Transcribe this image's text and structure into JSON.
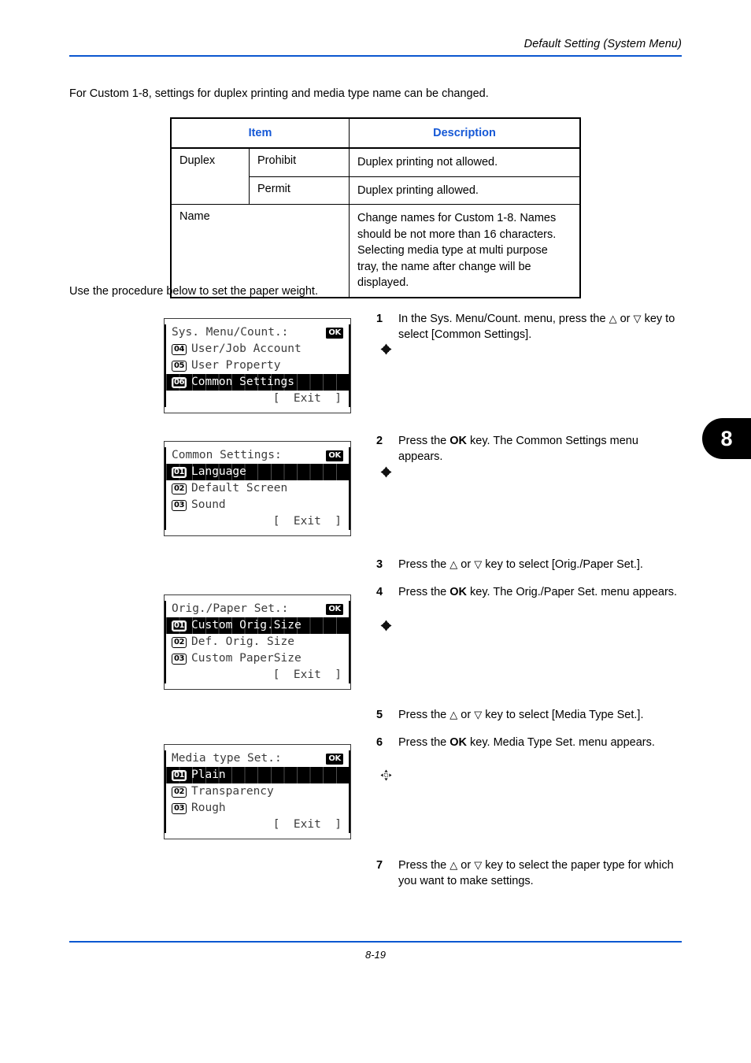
{
  "header": {
    "title": "Default Setting (System Menu)"
  },
  "footer": {
    "page_number": "8-19"
  },
  "chapter_tab": {
    "number": "8"
  },
  "intro": {
    "paragraph": "For Custom 1-8, settings for duplex printing and media type name can be changed.",
    "procedure_paragraph": "Use the procedure below to set the paper weight."
  },
  "spec_table": {
    "header_color": "#1558D6",
    "columns": [
      "Item",
      "Description"
    ],
    "rows": [
      {
        "item": "Duplex",
        "sub": "Prohibit",
        "description": "Duplex printing not allowed."
      },
      {
        "item": "",
        "sub": "Permit",
        "description": "Duplex printing allowed."
      },
      {
        "item": "Name",
        "sub": "",
        "description": "Change names for Custom 1-8. Names should be not more than 16 characters. Selecting media type at multi purpose tray, the name after change will be displayed."
      }
    ]
  },
  "lcd_screens": [
    {
      "title": "Sys. Menu/Count.:",
      "icons": [
        "four-way-arrow-icon",
        "ok-key-icon"
      ],
      "ok_label": "OK",
      "rows": [
        {
          "num": "04",
          "label": "User/Job Account",
          "selected": false
        },
        {
          "num": "05",
          "label": "User Property",
          "selected": false
        },
        {
          "num": "06",
          "label": "Common Settings",
          "selected": true
        }
      ],
      "exit_label": "[  Exit  ]"
    },
    {
      "title": "Common Settings:",
      "icons": [
        "four-way-arrow-icon",
        "ok-key-icon"
      ],
      "ok_label": "OK",
      "rows": [
        {
          "num": "01",
          "label": "Language",
          "selected": true
        },
        {
          "num": "02",
          "label": "Default Screen",
          "selected": false
        },
        {
          "num": "03",
          "label": "Sound",
          "selected": false
        }
      ],
      "exit_label": "[  Exit  ]"
    },
    {
      "title": "Orig./Paper Set.:",
      "icons": [
        "four-way-arrow-icon",
        "ok-key-icon"
      ],
      "ok_label": "OK",
      "rows": [
        {
          "num": "01",
          "label": "Custom Orig.Size",
          "selected": true
        },
        {
          "num": "02",
          "label": "Def. Orig. Size",
          "selected": false
        },
        {
          "num": "03",
          "label": "Custom PaperSize",
          "selected": false
        }
      ],
      "exit_label": "[  Exit  ]"
    },
    {
      "title": "Media type Set.:",
      "icons": [
        "four-way-arrow-dotted-icon",
        "ok-key-icon"
      ],
      "ok_label": "OK",
      "rows": [
        {
          "num": "01",
          "label": "Plain",
          "selected": true
        },
        {
          "num": "02",
          "label": "Transparency",
          "selected": false
        },
        {
          "num": "03",
          "label": "Rough",
          "selected": false
        }
      ],
      "exit_label": "[  Exit  ]"
    }
  ],
  "steps": [
    {
      "number": "1",
      "parts": [
        {
          "t": "In the Sys. Menu/Count. menu, press the ",
          "b": false
        },
        {
          "t": "△",
          "b": false
        },
        {
          "t": " or ",
          "b": false
        },
        {
          "t": "▽",
          "b": false
        },
        {
          "t": " key to select [Common Settings].",
          "b": false
        }
      ],
      "text": "In the Sys. Menu/Count. menu, press the △ or ▽ key to select [Common Settings]."
    },
    {
      "number": "2",
      "text": "Press the OK key. The Common Settings menu appears."
    },
    {
      "number": "3",
      "text": "Press the △ or ▽ key to select [Orig./Paper Set.]."
    },
    {
      "number": "4",
      "text": "Press the OK key. The Orig./Paper Set. menu appears."
    },
    {
      "number": "5",
      "text": "Press the △ or ▽ key to select [Media Type Set.]."
    },
    {
      "number": "6",
      "text": "Press the OK key. Media Type Set. menu appears."
    },
    {
      "number": "7",
      "text": "Press the △ or ▽ key to select the paper type for which you want to make settings."
    }
  ],
  "step_fragments": {
    "s1_a": "In the Sys. Menu/Count. menu, press the ",
    "s1_b": " or ",
    "s1_c": " key to select [Common Settings].",
    "s2_a": "Press the ",
    "s2_ok": "OK",
    "s2_b": " key. The Common Settings menu appears.",
    "s3_a": "Press the ",
    "s3_b": " or ",
    "s3_c": " key to select [Orig./Paper Set.].",
    "s4_a": "Press the ",
    "s4_ok": "OK",
    "s4_b": " key. The Orig./Paper Set. menu appears.",
    "s5_a": "Press the ",
    "s5_b": " or ",
    "s5_c": " key to select [Media Type Set.].",
    "s6_a": "Press the ",
    "s6_ok": "OK",
    "s6_b": " key. Media Type Set. menu appears.",
    "s7_a": "Press the ",
    "s7_b": " or ",
    "s7_c": " key to select the paper type for which you want to make settings.",
    "up_arrow": "△",
    "down_arrow": "▽"
  }
}
